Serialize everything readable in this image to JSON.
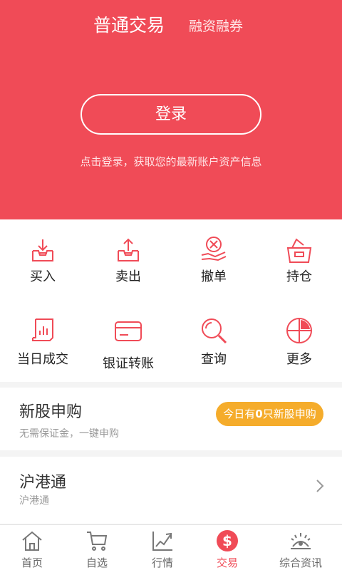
{
  "header": {
    "tab_main": "普通交易",
    "tab_alt": "融资融券",
    "login_button": "登录",
    "login_hint": "点击登录，获取您的最新账户资产信息"
  },
  "functions": [
    {
      "label": "买入",
      "icon": "buy-tray-icon"
    },
    {
      "label": "卖出",
      "icon": "sell-tray-icon"
    },
    {
      "label": "撤单",
      "icon": "cancel-order-icon"
    },
    {
      "label": "持仓",
      "icon": "holdings-basket-icon"
    },
    {
      "label": "当日成交",
      "icon": "daily-deals-scroll-icon"
    },
    {
      "label": "银证转账",
      "icon": "bank-card-icon"
    },
    {
      "label": "查询",
      "icon": "search-icon"
    },
    {
      "label": "更多",
      "icon": "more-pie-icon"
    }
  ],
  "ipo": {
    "title": "新股申购",
    "subtitle": "无需保证金，一键申购",
    "badge_prefix": "今日有",
    "badge_count": "0",
    "badge_suffix": "只新股申购"
  },
  "hk_connect": {
    "title": "沪港通",
    "subtitle": "沪港通"
  },
  "bottom_nav": [
    {
      "label": "首页",
      "icon": "home-icon",
      "active": false
    },
    {
      "label": "自选",
      "icon": "cart-icon",
      "active": false
    },
    {
      "label": "行情",
      "icon": "trend-chart-icon",
      "active": false
    },
    {
      "label": "交易",
      "icon": "dollar-icon",
      "active": true
    },
    {
      "label": "综合资讯",
      "icon": "news-eye-icon",
      "active": false
    }
  ],
  "colors": {
    "primary": "#f04b57",
    "badge": "#f5ac2b"
  }
}
